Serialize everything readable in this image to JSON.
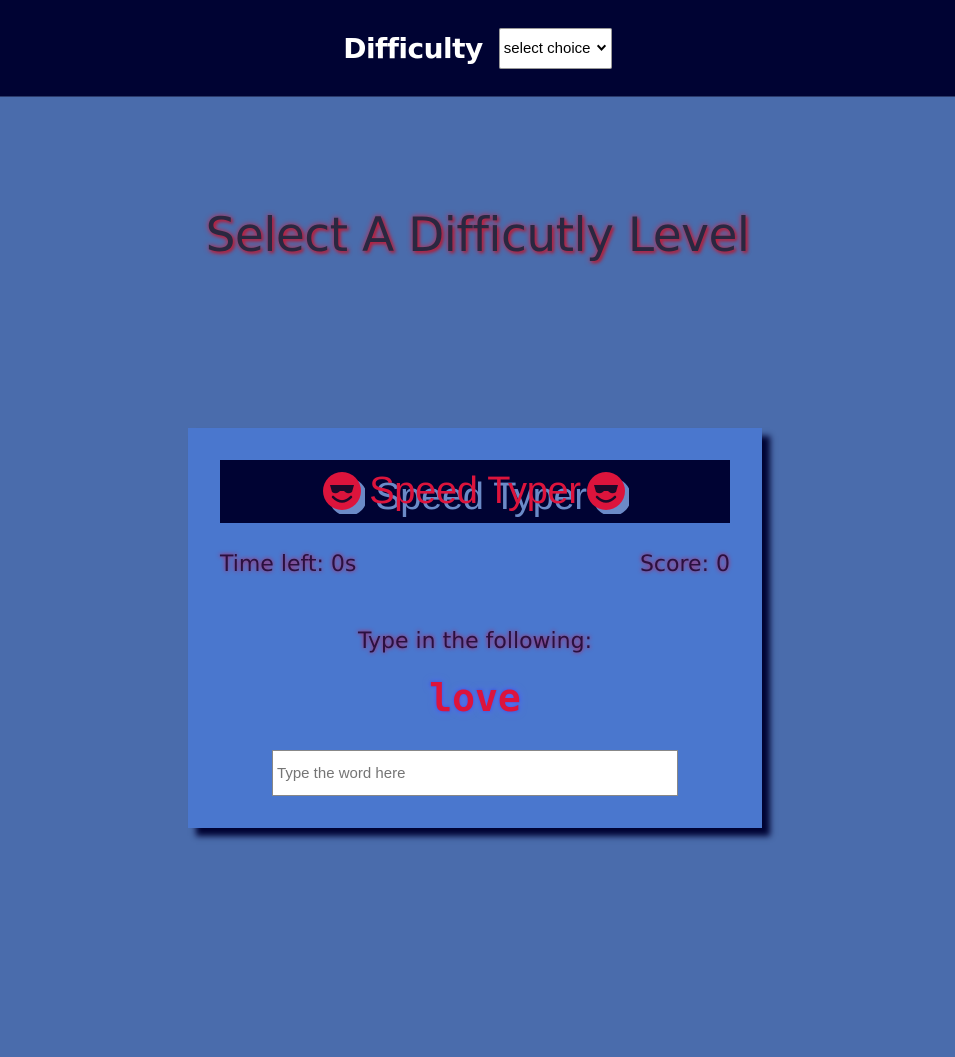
{
  "header": {
    "difficulty_label": "Difficulty",
    "select_value": "select choice",
    "background_color": "#000333"
  },
  "main": {
    "headline": "Select A Difficutly Level"
  },
  "game": {
    "title": "Speed Typer",
    "emoji_icon": "smiling-face-with-sunglasses-icon",
    "time_left": "Time left: 0s",
    "score": "Score: 0",
    "prompt": "Type in the following:",
    "word": "love",
    "input_placeholder": "Type the word here",
    "input_value": "",
    "accent_color": "#dc143c",
    "card_color": "#4a77ce"
  },
  "page": {
    "background_color": "#4a6cac"
  }
}
